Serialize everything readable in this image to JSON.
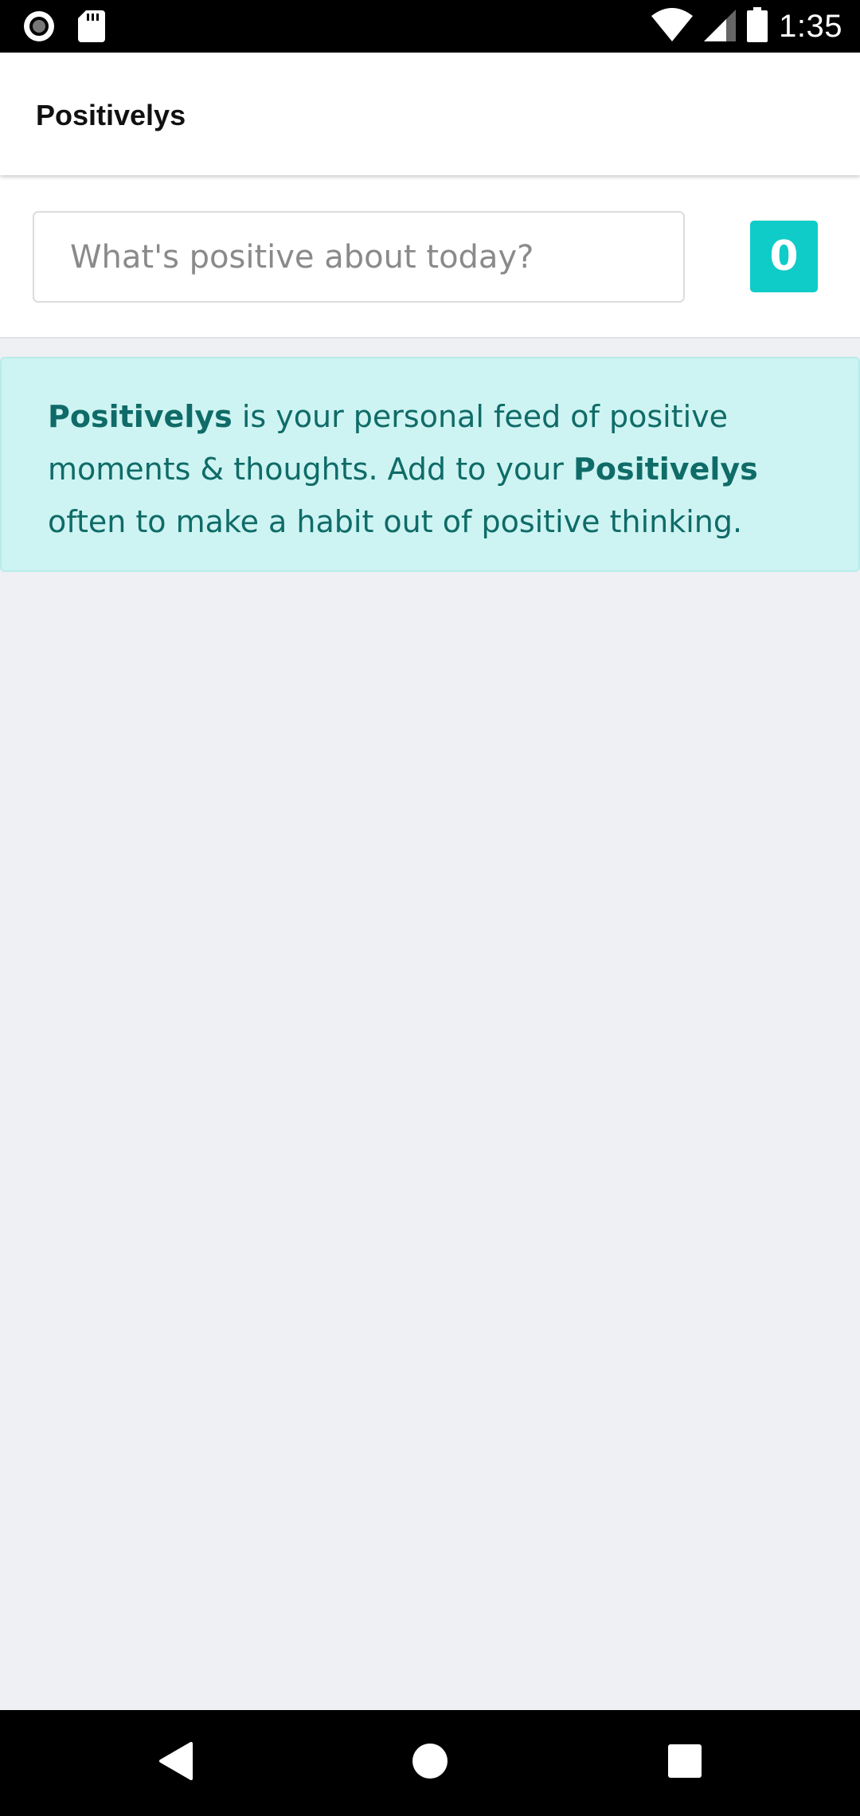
{
  "status_bar": {
    "time": "1:35",
    "left_icons": [
      "record-icon",
      "sd-card-icon"
    ],
    "right_icons": [
      "wifi-icon",
      "cellular-signal-icon",
      "battery-icon"
    ]
  },
  "header": {
    "title": "Positivelys"
  },
  "composer": {
    "placeholder": "What's positive about today?",
    "value": "",
    "count": "0"
  },
  "info": {
    "brand_1": "Positivelys",
    "text_1": " is your personal feed of positive moments & thoughts. Add to your ",
    "brand_2": "Positivelys",
    "text_2": " often to make a habit out of positive thinking."
  },
  "nav_bar": {
    "buttons": [
      "back-icon",
      "home-icon",
      "recents-icon"
    ]
  },
  "colors": {
    "accent": "#0fccc8",
    "info_background": "#cdf4f2",
    "info_text": "#0f6b68",
    "page_background": "#eff0f4"
  }
}
